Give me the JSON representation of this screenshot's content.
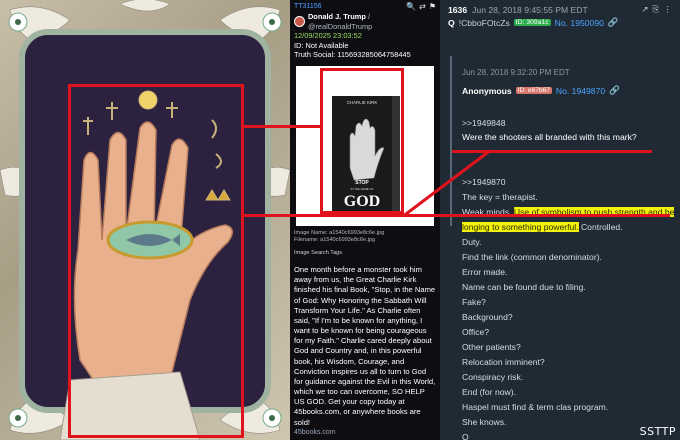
{
  "post": {
    "thread_id": "TT31156",
    "display_name": "Donald J. Trump",
    "handle": "/ @realDonaldTrump",
    "date": "12/09/2025 23:03:52",
    "id_line": "ID: Not Available",
    "truth_social": "Truth Social: 115693285064758445",
    "book_author": "CHARLIE KIRK",
    "book_title_top": "STOP",
    "book_title_mid": "IN THE NAME OF",
    "book_title_main": "GOD",
    "image_name": "Image Name: a1540c6993e8c6e.jpg",
    "filename": "Filename: a1540c6993e8c6e.jpg",
    "image_search": "Image Search Tags",
    "body": "One month before a monster took him away from us, the Great Charlie Kirk finished his final Book, \"Stop, in the Name of God: Why Honoring the Sabbath Will Transform Your Life.\" As Charlie often said, \"If I'm to be known for anything, I want to be known for being courageous for my Faith.\" Charlie cared deeply about God and Country and, in this powerful book, his Wisdom, Courage, and Conviction inspires us all to turn to God for guidance against the Evil in this World, which we too can overcome, SO HELP US GOD. Get your copy today at 45books.com, or anywhere books are sold!",
    "footer": "45books.com"
  },
  "q": {
    "post_num": "1636",
    "post_date": "Jun 28, 2018 9:45:55 PM EDT",
    "name": "Q",
    "trip": "!CbboFOtcZs",
    "id": "ID: 309a1c",
    "no": "No. 1950090",
    "quote": {
      "date": "Jun 28, 2018 9:32:20 PM EDT",
      "name": "Anonymous",
      "id": "ID: e67b67",
      "no": "No. 1949870",
      "ref": ">>1949848",
      "text": "Were the shooters all branded with this mark?"
    },
    "lines": {
      "l1": ">>1949870",
      "l2": "The key = therapist.",
      "l3a": "Weak minds.",
      "l3b": "Use of symbolism to push strength and be",
      "l4a": "longing to something powerful.",
      "l4b": "Controlled.",
      "l5": "Duty.",
      "l6": "Find the link (common denominator).",
      "l7": "Error made.",
      "l8": "Name can be found due to filing.",
      "l9": "Fake?",
      "l10": "Background?",
      "l11": "Office?",
      "l12": "Other patients?",
      "l13": "Relocation imminent?",
      "l14": "Conspiracy risk.",
      "l15": "End (for now).",
      "l16": "Haspel must find & term clas program.",
      "l17": "She knows.",
      "l18": "Q"
    }
  },
  "credit": "SSTTP",
  "colors": {
    "accent_red": "#e0131c",
    "highlight": "#f2f20a",
    "q_bg": "#1f2a35",
    "link_blue": "#4da3ff"
  }
}
